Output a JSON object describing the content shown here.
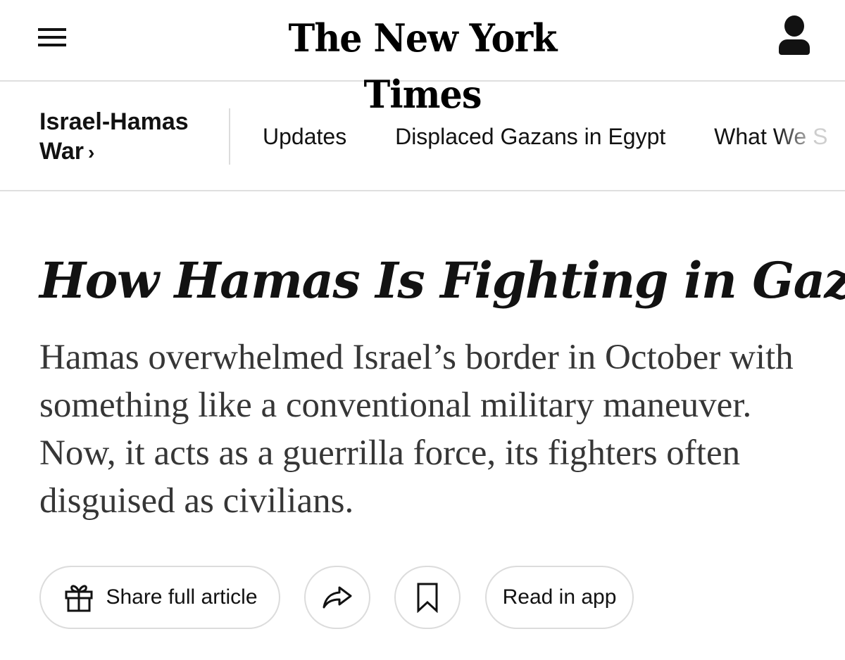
{
  "masthead": {
    "logo_text": "The New York Times",
    "menu_icon": "hamburger-menu-icon",
    "account_icon": "account-icon"
  },
  "section_nav": {
    "section_title_line1": "Israel-Hamas",
    "section_title_line2": "War",
    "chevron": "›",
    "links": [
      {
        "label": "Updates"
      },
      {
        "label": "Displaced Gazans in Egypt"
      },
      {
        "label": "What We S"
      }
    ]
  },
  "article": {
    "headline": "How Hamas Is Fighting in Gaza",
    "summary": "Hamas overwhelmed Israel’s border in October with something like a conventional military maneuver. Now, it acts as a guerrilla force, its fighters often disguised as civilians."
  },
  "actions": {
    "share_full_label": "Share full article",
    "read_in_app_label": "Read in app",
    "icons": [
      "gift-icon",
      "share-arrow-icon",
      "bookmark-icon"
    ]
  },
  "colors": {
    "text": "#121212",
    "summary_text": "#363636",
    "divider": "#dfdfdf",
    "button_border": "#dcdcdc"
  }
}
